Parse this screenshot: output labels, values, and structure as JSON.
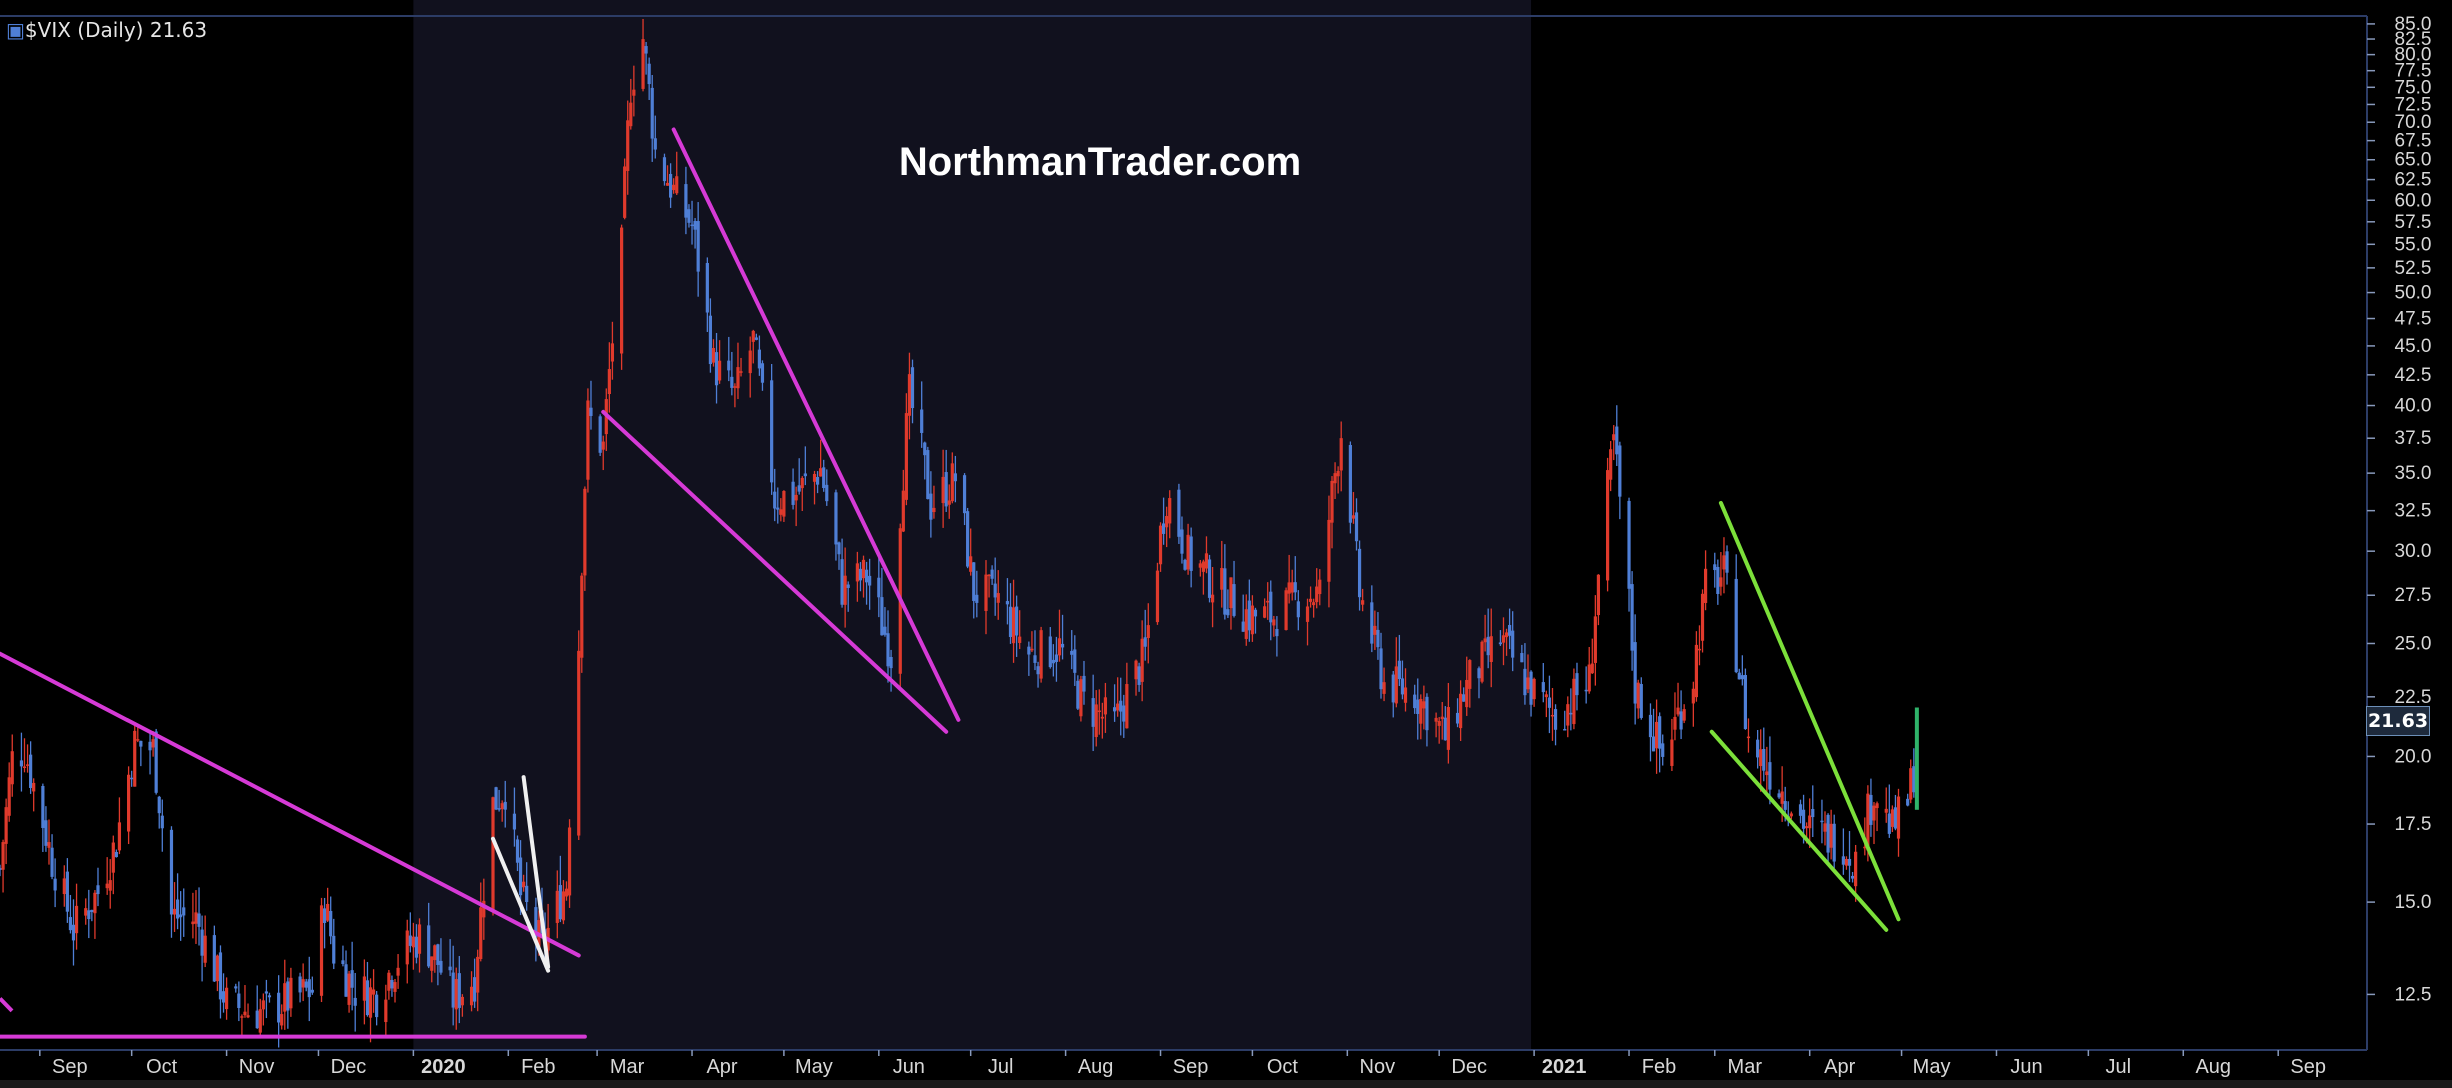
{
  "header": {
    "title": "$VIX (Daily) 21.63"
  },
  "watermark": "NorthmanTrader.com",
  "last_value_badge": "21.63",
  "colors": {
    "background": "#000000",
    "shaded_region": "#11111e",
    "up_candle": "#4f7fd6",
    "down_candle": "#e03a2c",
    "magenta_trendline": "#d63ad6",
    "green_trendline": "#7ce03a",
    "white_trendline": "#f0f0f0",
    "axis_text": "#d8d8d8"
  },
  "chart_data": {
    "type": "candlestick",
    "title": "$VIX (Daily) 21.63",
    "last_value": 21.63,
    "x_range": [
      "2019-08-19",
      "2021-09-30"
    ],
    "y_axis": {
      "position": "right",
      "scale": "log",
      "ylim": [
        11.2,
        86
      ],
      "ticks": [
        12.5,
        15.0,
        17.5,
        20.0,
        22.5,
        25.0,
        27.5,
        30.0,
        32.5,
        35.0,
        37.5,
        40.0,
        42.5,
        45.0,
        47.5,
        50.0,
        52.5,
        55.0,
        57.5,
        60.0,
        62.5,
        65.0,
        67.5,
        70.0,
        72.5,
        75.0,
        77.5,
        80.0,
        82.5,
        85.0
      ]
    },
    "x_axis": {
      "tick_labels": [
        {
          "date": "2019-09-01",
          "label": "Sep"
        },
        {
          "date": "2019-10-01",
          "label": "Oct"
        },
        {
          "date": "2019-11-01",
          "label": "Nov"
        },
        {
          "date": "2019-12-01",
          "label": "Dec"
        },
        {
          "date": "2020-01-01",
          "label": "2020",
          "bold": true
        },
        {
          "date": "2020-02-01",
          "label": "Feb"
        },
        {
          "date": "2020-03-01",
          "label": "Mar"
        },
        {
          "date": "2020-04-01",
          "label": "Apr"
        },
        {
          "date": "2020-05-01",
          "label": "May"
        },
        {
          "date": "2020-06-01",
          "label": "Jun"
        },
        {
          "date": "2020-07-01",
          "label": "Jul"
        },
        {
          "date": "2020-08-01",
          "label": "Aug"
        },
        {
          "date": "2020-09-01",
          "label": "Sep"
        },
        {
          "date": "2020-10-01",
          "label": "Oct"
        },
        {
          "date": "2020-11-01",
          "label": "Nov"
        },
        {
          "date": "2020-12-01",
          "label": "Dec"
        },
        {
          "date": "2021-01-01",
          "label": "2021",
          "bold": true
        },
        {
          "date": "2021-02-01",
          "label": "Feb"
        },
        {
          "date": "2021-03-01",
          "label": "Mar"
        },
        {
          "date": "2021-04-01",
          "label": "Apr"
        },
        {
          "date": "2021-05-01",
          "label": "May"
        },
        {
          "date": "2021-06-01",
          "label": "Jun"
        },
        {
          "date": "2021-07-01",
          "label": "Jul"
        },
        {
          "date": "2021-08-01",
          "label": "Aug"
        },
        {
          "date": "2021-09-01",
          "label": "Sep"
        }
      ]
    },
    "shaded_period": [
      "2020-01-01",
      "2020-12-31"
    ],
    "series": [
      {
        "type": "ohlc_close",
        "points": [
          [
            "2019-08-19",
            16.0
          ],
          [
            "2019-08-23",
            19.9
          ],
          [
            "2019-08-27",
            20.3
          ],
          [
            "2019-08-30",
            18.9
          ],
          [
            "2019-09-05",
            16.3
          ],
          [
            "2019-09-12",
            14.2
          ],
          [
            "2019-09-20",
            15.3
          ],
          [
            "2019-09-26",
            16.9
          ],
          [
            "2019-10-02",
            20.5
          ],
          [
            "2019-10-08",
            20.3
          ],
          [
            "2019-10-14",
            14.6
          ],
          [
            "2019-10-22",
            14.5
          ],
          [
            "2019-11-01",
            12.3
          ],
          [
            "2019-11-08",
            12.1
          ],
          [
            "2019-11-15",
            12.1
          ],
          [
            "2019-11-22",
            12.4
          ],
          [
            "2019-11-29",
            12.6
          ],
          [
            "2019-12-03",
            15.0
          ],
          [
            "2019-12-06",
            13.6
          ],
          [
            "2019-12-13",
            12.6
          ],
          [
            "2019-12-20",
            12.5
          ],
          [
            "2019-12-27",
            13.4
          ],
          [
            "2019-12-31",
            13.8
          ],
          [
            "2020-01-03",
            14.0
          ],
          [
            "2020-01-08",
            13.5
          ],
          [
            "2020-01-14",
            12.4
          ],
          [
            "2020-01-21",
            12.9
          ],
          [
            "2020-01-27",
            18.2
          ],
          [
            "2020-01-31",
            18.8
          ],
          [
            "2020-02-05",
            15.2
          ],
          [
            "2020-02-12",
            13.7
          ],
          [
            "2020-02-20",
            15.6
          ],
          [
            "2020-02-24",
            25.0
          ],
          [
            "2020-02-27",
            39.2
          ],
          [
            "2020-03-03",
            36.8
          ],
          [
            "2020-03-09",
            54.5
          ],
          [
            "2020-03-12",
            75.5
          ],
          [
            "2020-03-16",
            82.7
          ],
          [
            "2020-03-20",
            66.0
          ],
          [
            "2020-03-26",
            61.0
          ],
          [
            "2020-04-01",
            57.1
          ],
          [
            "2020-04-08",
            43.4
          ],
          [
            "2020-04-15",
            40.8
          ],
          [
            "2020-04-21",
            45.4
          ],
          [
            "2020-04-28",
            33.3
          ],
          [
            "2020-05-05",
            33.6
          ],
          [
            "2020-05-13",
            35.3
          ],
          [
            "2020-05-20",
            27.9
          ],
          [
            "2020-05-28",
            28.6
          ],
          [
            "2020-06-05",
            24.5
          ],
          [
            "2020-06-11",
            40.8
          ],
          [
            "2020-06-18",
            32.9
          ],
          [
            "2020-06-26",
            34.7
          ],
          [
            "2020-07-02",
            27.7
          ],
          [
            "2020-07-10",
            27.3
          ],
          [
            "2020-07-20",
            24.5
          ],
          [
            "2020-07-30",
            24.8
          ],
          [
            "2020-08-07",
            22.2
          ],
          [
            "2020-08-17",
            21.3
          ],
          [
            "2020-08-27",
            24.5
          ],
          [
            "2020-09-03",
            33.6
          ],
          [
            "2020-09-10",
            29.7
          ],
          [
            "2020-09-21",
            27.8
          ],
          [
            "2020-09-30",
            26.4
          ],
          [
            "2020-10-08",
            26.4
          ],
          [
            "2020-10-16",
            27.4
          ],
          [
            "2020-10-23",
            27.6
          ],
          [
            "2020-10-30",
            38.0
          ],
          [
            "2020-11-05",
            27.6
          ],
          [
            "2020-11-13",
            23.1
          ],
          [
            "2020-11-23",
            22.7
          ],
          [
            "2020-12-03",
            20.8
          ],
          [
            "2020-12-11",
            23.3
          ],
          [
            "2020-12-21",
            25.2
          ],
          [
            "2020-12-31",
            22.8
          ],
          [
            "2021-01-08",
            21.6
          ],
          [
            "2021-01-19",
            23.2
          ],
          [
            "2021-01-27",
            37.2
          ],
          [
            "2021-02-03",
            22.9
          ],
          [
            "2021-02-12",
            19.97
          ],
          [
            "2021-02-22",
            23.5
          ],
          [
            "2021-02-26",
            27.9
          ],
          [
            "2021-03-04",
            28.6
          ],
          [
            "2021-03-12",
            20.7
          ],
          [
            "2021-03-22",
            18.9
          ],
          [
            "2021-04-01",
            17.3
          ],
          [
            "2021-04-12",
            16.9
          ],
          [
            "2021-04-16",
            16.2
          ],
          [
            "2021-04-22",
            18.7
          ],
          [
            "2021-04-28",
            17.3
          ],
          [
            "2021-05-03",
            18.3
          ],
          [
            "2021-05-05",
            19.5
          ],
          [
            "2021-05-06",
            21.63
          ]
        ]
      }
    ],
    "trendlines": [
      {
        "color": "magenta",
        "from": [
          "2019-08-19",
          24.5
        ],
        "to": [
          "2020-02-24",
          13.5
        ]
      },
      {
        "color": "magenta",
        "from": [
          "2019-08-19",
          11.5
        ],
        "to": [
          "2020-02-26",
          11.5
        ]
      },
      {
        "color": "magenta",
        "from": [
          "2020-03-03",
          39.5
        ],
        "to": [
          "2020-06-23",
          21.0
        ]
      },
      {
        "color": "magenta",
        "from": [
          "2020-03-26",
          69.0
        ],
        "to": [
          "2020-06-27",
          21.5
        ]
      },
      {
        "color": "white",
        "from": [
          "2020-01-27",
          17.0
        ],
        "to": [
          "2020-02-14",
          13.1
        ]
      },
      {
        "color": "white",
        "from": [
          "2020-02-06",
          19.2
        ],
        "to": [
          "2020-02-14",
          13.2
        ]
      },
      {
        "color": "green",
        "from": [
          "2021-02-28",
          21.0
        ],
        "to": [
          "2021-04-26",
          14.2
        ]
      },
      {
        "color": "green",
        "from": [
          "2021-03-03",
          33.0
        ],
        "to": [
          "2021-04-30",
          14.5
        ]
      }
    ]
  }
}
